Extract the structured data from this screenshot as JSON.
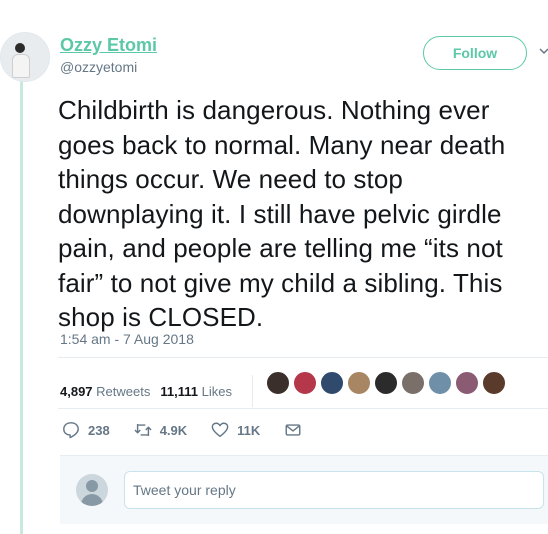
{
  "tweet": {
    "author_name": "Ozzy Etomi",
    "author_handle": "@ozzyetomi",
    "follow_label": "Follow",
    "text": "Childbirth is dangerous. Nothing ever goes back to normal. Many near death things occur. We need to stop downplaying it. I still have pelvic girdle pain, and people are telling me “its not fair” to not give my child a sibling. This shop is CLOSED.",
    "timestamp": "1:54 am - 7 Aug 2018"
  },
  "stats": {
    "retweets_count": "4,897",
    "retweets_label": "Retweets",
    "likes_count": "11,111",
    "likes_label": "Likes"
  },
  "likers": [
    {
      "color": "#3a2f2b"
    },
    {
      "color": "#b5374a"
    },
    {
      "color": "#2f4a6d"
    },
    {
      "color": "#a98663"
    },
    {
      "color": "#2b2b2b"
    },
    {
      "color": "#7b6f69"
    },
    {
      "color": "#6f8fa8"
    },
    {
      "color": "#8b5a73"
    },
    {
      "color": "#5a3a2a"
    }
  ],
  "actions": {
    "reply_count": "238",
    "retweet_count": "4.9K",
    "like_count": "11K"
  },
  "reply_box": {
    "placeholder": "Tweet your reply"
  },
  "colors": {
    "accent": "#5cc8a8",
    "muted": "#657786"
  }
}
